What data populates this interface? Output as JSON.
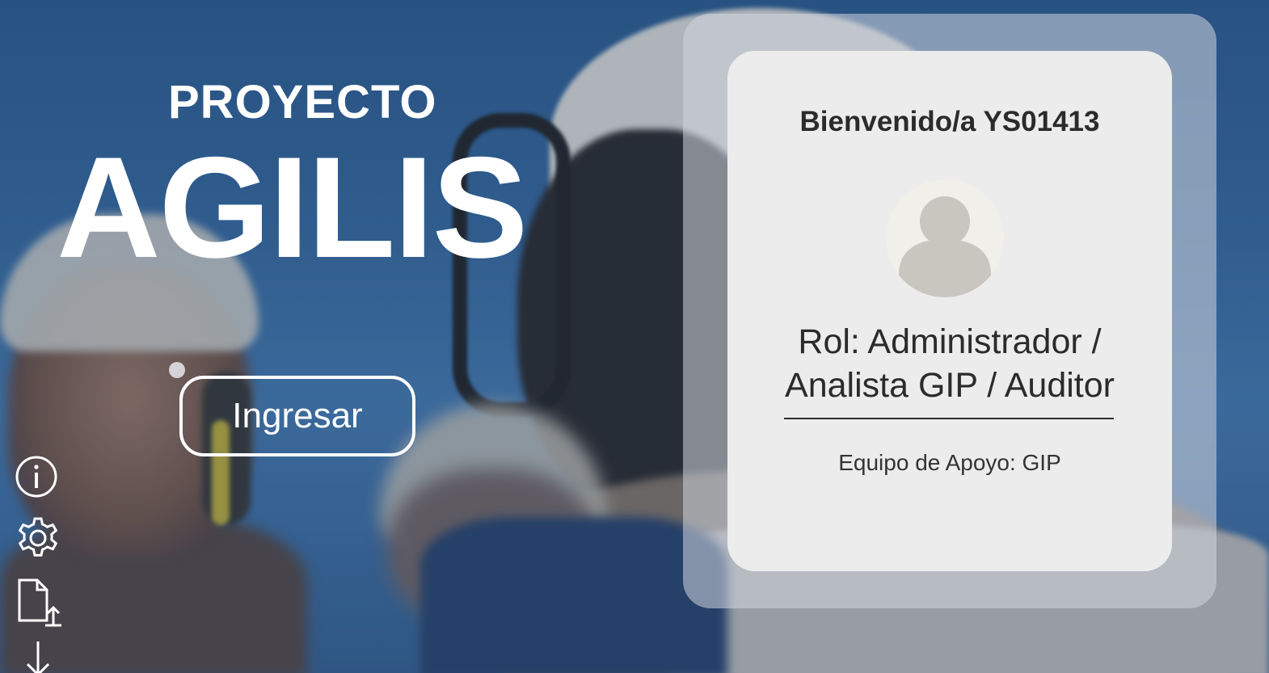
{
  "brand": {
    "prefix": "PROYECTO",
    "name": "AGILIS"
  },
  "actions": {
    "enter_label": "Ingresar"
  },
  "tools": [
    {
      "icon": "info-icon"
    },
    {
      "icon": "gear-icon"
    },
    {
      "icon": "file-upload-icon"
    },
    {
      "icon": "download-icon"
    }
  ],
  "profile": {
    "welcome": "Bienvenido/a YS01413",
    "avatar_icon": "user-avatar-icon",
    "role_line1": "Rol: Administrador /",
    "role_line2": "Analista GIP / Auditor",
    "team": "Equipo de Apoyo: GIP"
  },
  "colors": {
    "background": "#3b6ea3",
    "panel": "#ececec",
    "text_dark": "#2b2b2b",
    "brand_text": "#ffffff"
  }
}
